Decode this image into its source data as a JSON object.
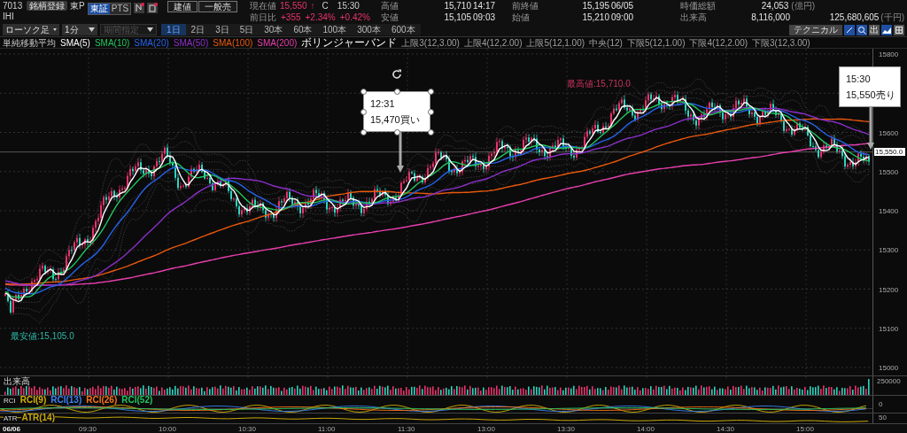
{
  "header": {
    "code": "7013",
    "name": "IHI",
    "register_button": "銘柄登録",
    "market": "東P",
    "exchange_tabs": [
      {
        "label": "東証",
        "selected": true
      },
      {
        "label": "PTS",
        "selected": false
      }
    ],
    "order_buttons": [
      "建値",
      "一般売"
    ]
  },
  "quote": {
    "current": {
      "label": "現在値",
      "value": "15,550",
      "arrow": "↑",
      "flag": "C",
      "time": "15:30"
    },
    "change": {
      "label": "前日比",
      "values": [
        "+355",
        "+2.34%",
        "+0.42%"
      ]
    }
  },
  "stats": [
    {
      "label": "高値",
      "value": "15,710",
      "time": "14:17"
    },
    {
      "label": "安値",
      "value": "15,105",
      "time": "09:03"
    },
    {
      "label": "前終値",
      "value": "15,195",
      "time": "06/05"
    },
    {
      "label": "始値",
      "value": "15,210",
      "time": "09:00"
    },
    {
      "label": "時価総額",
      "value": "24,053",
      "unit": "(億円)"
    },
    {
      "label": "出来高",
      "value": "8,116,000"
    }
  ],
  "turnover": {
    "value": "125,680,605",
    "unit": "(千円)"
  },
  "toolbar": {
    "dropdowns": [
      {
        "label": "ローソク足",
        "disabled": false
      },
      {
        "label": "1分",
        "disabled": false
      },
      {
        "label": "期間指定",
        "disabled": true
      }
    ],
    "periods": [
      {
        "label": "1日",
        "selected": true
      },
      {
        "label": "2日",
        "selected": false
      },
      {
        "label": "3日",
        "selected": false
      },
      {
        "label": "5日",
        "selected": false
      },
      {
        "label": "30本",
        "selected": false
      },
      {
        "label": "60本",
        "selected": false
      },
      {
        "label": "100本",
        "selected": false
      },
      {
        "label": "300本",
        "selected": false
      },
      {
        "label": "600本",
        "selected": false
      }
    ],
    "technical_button": "テクニカル",
    "volume_toggle": "出"
  },
  "legend": {
    "ma_title": "単純移動平均",
    "ma": [
      {
        "label": "SMA(5)",
        "color": "#ffffff"
      },
      {
        "label": "SMA(10)",
        "color": "#22c55e"
      },
      {
        "label": "SMA(20)",
        "color": "#2563eb"
      },
      {
        "label": "SMA(50)",
        "color": "#8b2fc9"
      },
      {
        "label": "SMA(100)",
        "color": "#ea580c"
      },
      {
        "label": "SMA(200)",
        "color": "#e83fae"
      }
    ],
    "bb_title": "ボリンジャーバンド",
    "bb": [
      "上限3(12,3.00)",
      "上限4(12,2.00)",
      "上限5(12,1.00)",
      "中央(12)",
      "下限5(12,1.00)",
      "下限4(12,2.00)",
      "下限3(12,3.00)"
    ]
  },
  "chart": {
    "y_labels": [
      "15800",
      "15600",
      "15500",
      "15400",
      "15300",
      "15200",
      "15100",
      "15000"
    ],
    "current_price": "15,550.0",
    "high_marker": "最高値:15,710.0",
    "low_marker": "最安値:15,105.0",
    "callouts": [
      {
        "time": "12:31",
        "text": "15,470買い",
        "selected": true
      },
      {
        "time": "15:30",
        "text": "15,550売り",
        "selected": false
      }
    ]
  },
  "volume": {
    "title": "出来高",
    "scale": "250000"
  },
  "rci": {
    "title": "RCI",
    "series": [
      {
        "label": "RCI(9)",
        "color": "#d4b106"
      },
      {
        "label": "RCI(13)",
        "color": "#3b82f6"
      },
      {
        "label": "RCI(26)",
        "color": "#f97316"
      },
      {
        "label": "RCI(52)",
        "color": "#22c55e"
      }
    ],
    "scale": "0"
  },
  "atr": {
    "title": "ATR",
    "series": [
      {
        "label": "ATR(14)",
        "color": "#c9a90a"
      }
    ],
    "scale": "50"
  },
  "x_labels": [
    "06/06",
    "09:30",
    "10:00",
    "10:30",
    "11:00",
    "11:30",
    "13:00",
    "13:30",
    "14:00",
    "14:30",
    "15:00"
  ]
}
